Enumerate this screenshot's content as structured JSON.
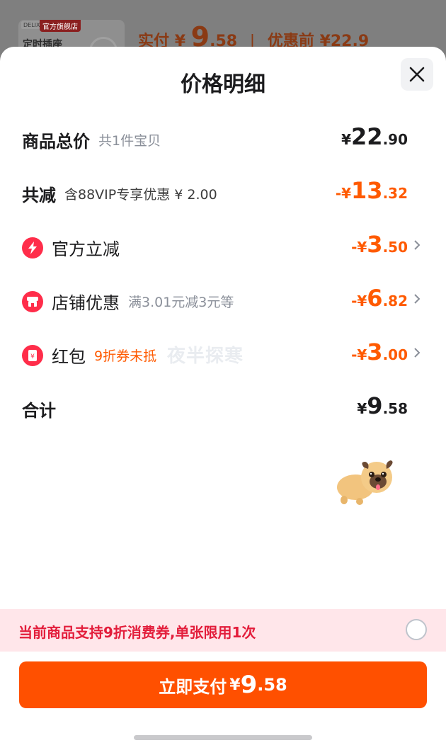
{
  "background": {
    "shop_brand": "DELIXI",
    "shop_tag": "官方旗舰店",
    "product_name": "定时插座",
    "paid_label": "实付",
    "paid_currency": "¥",
    "paid_int": "9",
    "paid_dec": ".58",
    "before_label": "优惠前",
    "before_price": "¥22.9"
  },
  "sheet": {
    "title": "价格明细",
    "close_icon": "close-icon"
  },
  "rows": {
    "total_goods": {
      "label": "商品总价",
      "sub": "共1件宝贝",
      "currency": "¥",
      "int": "22",
      "dec": ".90"
    },
    "discount_total": {
      "label": "共减",
      "sub": "含88VIP专享优惠 ¥ 2.00",
      "currency": "-¥",
      "int": "13",
      "dec": ".32"
    },
    "official": {
      "label": "官方立减",
      "currency": "-¥",
      "int": "3",
      "dec": ".50",
      "icon": "lightning-icon"
    },
    "shop": {
      "label": "店铺优惠",
      "sub": "满3.01元减3元等",
      "currency": "-¥",
      "int": "6",
      "dec": ".82",
      "icon": "shop-icon"
    },
    "red_packet": {
      "label": "红包",
      "sub": "9折券未抵",
      "currency": "-¥",
      "int": "3",
      "dec": ".00",
      "icon": "red-packet-icon"
    },
    "sum": {
      "label": "合计",
      "currency": "¥",
      "int": "9",
      "dec": ".58"
    }
  },
  "watermark": "夜半探寒",
  "coupon": {
    "text": "当前商品支持9折消费券,单张限用1次",
    "selected": false
  },
  "pay_button": {
    "label": "立即支付",
    "currency": "¥",
    "int": "9",
    "dec": ".58"
  },
  "colors": {
    "accent_orange": "#ff5000",
    "discount_orange": "#ff5a00",
    "icon_red": "#ff2d4a",
    "coupon_bg": "#ffe6ea",
    "coupon_text": "#e31d3b"
  }
}
